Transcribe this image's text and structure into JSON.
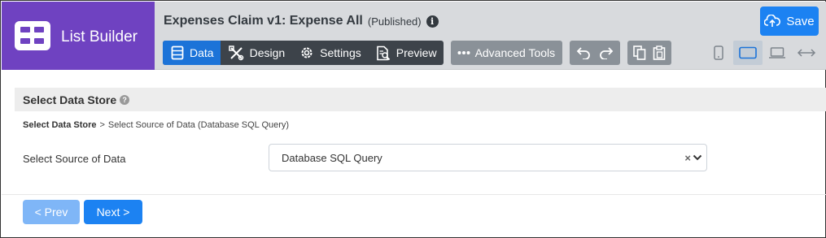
{
  "brand": {
    "title": "List Builder",
    "color": "#6f42c1"
  },
  "header": {
    "title": "Expenses Claim v1: Expense All",
    "status": "(Published)",
    "info_icon": "i"
  },
  "toolbar": {
    "tabs": [
      {
        "label": "Data",
        "icon": "database-icon",
        "active": true
      },
      {
        "label": "Design",
        "icon": "design-tools-icon",
        "active": false
      },
      {
        "label": "Settings",
        "icon": "gear-icon",
        "active": false
      },
      {
        "label": "Preview",
        "icon": "preview-document-icon",
        "active": false
      }
    ],
    "advanced": {
      "label": "Advanced Tools",
      "icon": "ellipsis-icon"
    },
    "undo_icon": "undo-icon",
    "redo_icon": "redo-icon",
    "copy_icon": "copy-icon",
    "paste_icon": "paste-icon"
  },
  "device_bar": {
    "devices": [
      {
        "name": "mobile",
        "icon": "mobile-icon",
        "active": false
      },
      {
        "name": "tablet",
        "icon": "tablet-icon",
        "active": true
      },
      {
        "name": "laptop",
        "icon": "laptop-icon",
        "active": false
      },
      {
        "name": "full-width",
        "icon": "arrows-horizontal-icon",
        "active": false
      }
    ]
  },
  "save_button": {
    "label": "Save",
    "icon": "cloud-upload-icon"
  },
  "section": {
    "title": "Select Data Store",
    "help_icon": "?"
  },
  "breadcrumb": {
    "first": "Select Data Store",
    "separator": ">",
    "current": "Select Source of Data (Database SQL Query)"
  },
  "form": {
    "label": "Select Source of Data",
    "selected_value": "Database SQL Query",
    "clear_glyph": "×"
  },
  "navigation": {
    "prev_label": "< Prev",
    "next_label": "Next >",
    "prev_enabled": false
  },
  "colors": {
    "accent": "#1c82f2",
    "active_tab": "#1c73d8",
    "tab_bar": "#3d434a",
    "header_bg": "#d8dadd",
    "disabled_button": "#7fb6f7"
  }
}
